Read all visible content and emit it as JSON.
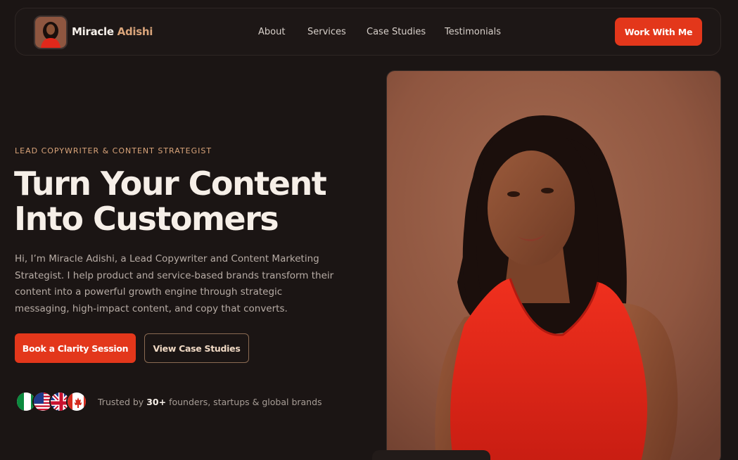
{
  "nav": {
    "brand_first": "Miracle",
    "brand_last": "Adishi",
    "links": [
      "About",
      "Services",
      "Case Studies",
      "Testimonials"
    ],
    "cta": "Work With Me"
  },
  "hero": {
    "eyebrow": "LEAD COPYWRITER & CONTENT STRATEGIST",
    "headline_line1": "Turn Your Content",
    "headline_line2": "Into Customers",
    "intro": "Hi, I’m Miracle Adishi, a Lead Copywriter and Content Marketing Strategist. I help product and service-based brands transform their content into a powerful growth engine through strategic messaging, high-impact content, and copy that converts.",
    "primary_button": "Book a Clarity Session",
    "secondary_button": "View Case Studies"
  },
  "trust": {
    "prefix": "Trusted by",
    "count": "30+",
    "suffix": "founders, startups & global brands",
    "flags": [
      "nigeria-flag-icon",
      "usa-flag-icon",
      "uk-flag-icon",
      "canada-flag-icon"
    ]
  },
  "colors": {
    "background": "#1b1514",
    "accent": "#e3371b",
    "gold": "#d9a47a",
    "photo_backdrop": "#9a5f46"
  }
}
